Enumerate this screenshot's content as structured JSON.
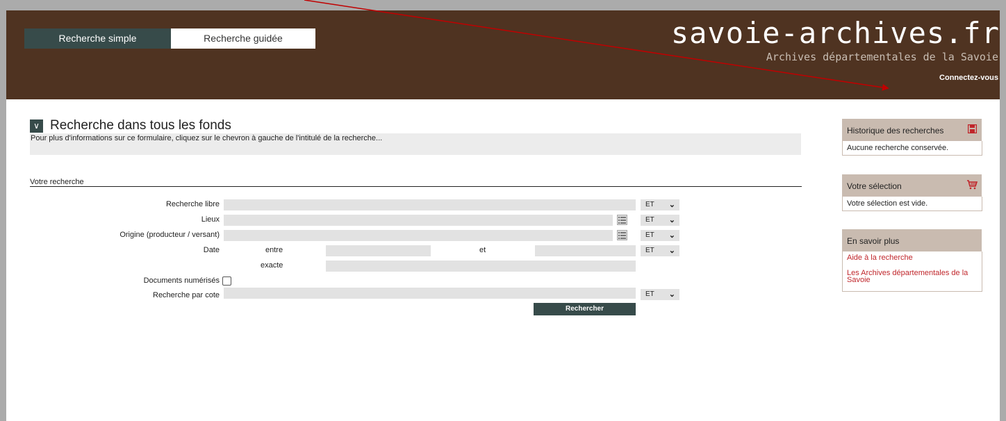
{
  "tabs": {
    "simple": "Recherche simple",
    "guided": "Recherche guidée"
  },
  "site": {
    "title": "savoie-archives.fr",
    "subtitle": "Archives départementales de la Savoie",
    "connect": "Connectez-vous"
  },
  "section": {
    "chevron": "∨",
    "title": "Recherche dans tous les fonds",
    "info": "Pour plus d'informations sur ce formulaire, cliquez sur le chevron à gauche de l'intitulé de la recherche..."
  },
  "form": {
    "heading": "Votre recherche",
    "free_label": "Recherche libre",
    "places_label": "Lieux",
    "origin_label": "Origine (producteur / versant)",
    "date_label": "Date",
    "between": "entre",
    "and": "et",
    "exact": "exacte",
    "digitized_label": "Documents numérisés",
    "cote_label": "Recherche par cote",
    "operator": "ET",
    "submit": "Rechercher"
  },
  "sidebar": {
    "history": {
      "title": "Historique des recherches",
      "body": "Aucune recherche conservée."
    },
    "selection": {
      "title": "Votre sélection",
      "body": "Votre sélection est vide."
    },
    "more": {
      "title": "En savoir plus",
      "link1": "Aide à la recherche",
      "link2": "Les Archives départementales de la Savoie"
    }
  },
  "colors": {
    "header": "#4f3321",
    "accent": "#374b4a",
    "sidebar_head": "#c9bbb0",
    "link": "#c0262b",
    "arrow": "#c00000"
  }
}
